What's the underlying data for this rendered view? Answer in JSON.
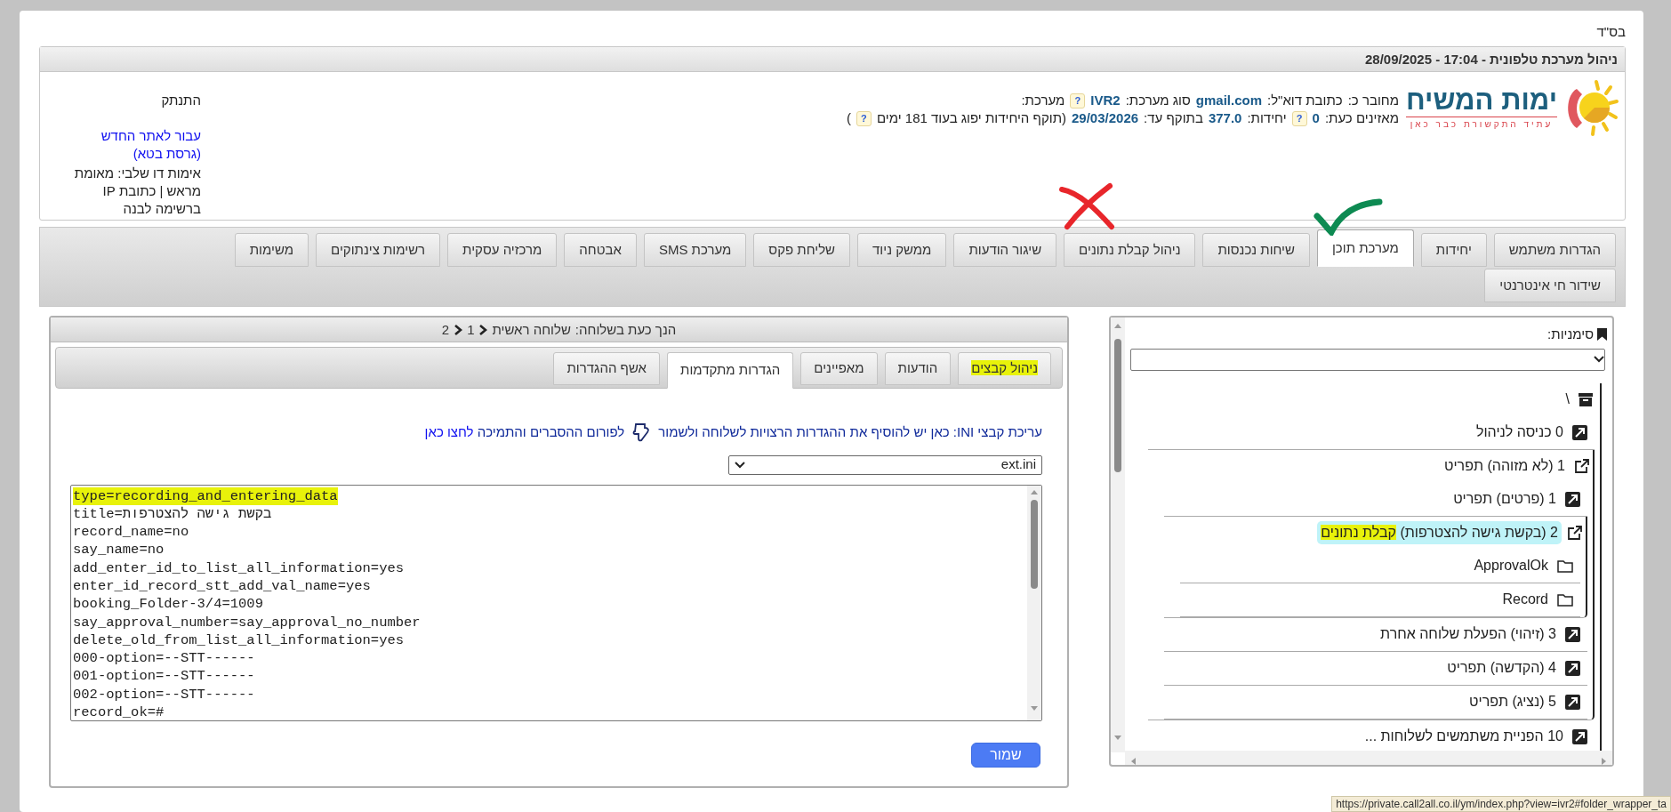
{
  "page_mark": "בס\"ד",
  "header": {
    "title": "ניהול מערכת טלפונית - 17:04 - 28/09/2025",
    "logo": {
      "name": "ימות המשיח",
      "slogan": "עתיד התקשורת כבר כאן"
    },
    "info_lines": [
      [
        {
          "kind": "label",
          "text": "מחובר כ:"
        },
        {
          "kind": "label",
          "text": "כתובת דוא\"ל:"
        },
        {
          "kind": "value",
          "text": "gmail.com"
        },
        {
          "kind": "label",
          "text": "סוג מערכת:"
        },
        {
          "kind": "value",
          "text": "IVR2"
        },
        {
          "kind": "help",
          "text": "?"
        },
        {
          "kind": "label",
          "text": "מערכת:"
        }
      ],
      [
        {
          "kind": "label",
          "text": "מאזינים כעת:"
        },
        {
          "kind": "value",
          "text": "0"
        },
        {
          "kind": "help",
          "text": "?"
        },
        {
          "kind": "label",
          "text": "יחידות:"
        },
        {
          "kind": "value",
          "text": "377.0"
        },
        {
          "kind": "label",
          "text": "בתוקף עד:"
        },
        {
          "kind": "value",
          "text": "29/03/2026"
        },
        {
          "kind": "label",
          "text": "(תוקף היחידות יפוג בעוד 181 ימים"
        },
        {
          "kind": "help",
          "text": "?"
        },
        {
          "kind": "label",
          "text": ")"
        }
      ]
    ],
    "side": {
      "logout": "התנתק",
      "new_site_link": "עבור לאתר החדש (גרסת בטא)",
      "two_factor": "אימות דו שלבי: מאומת מראש | כתובת IP ברשימה לבנה"
    }
  },
  "main_tabs": [
    {
      "label": "הגדרות משתמש",
      "selected": false
    },
    {
      "label": "יחידות",
      "selected": false
    },
    {
      "label": "מערכת תוכן",
      "selected": true
    },
    {
      "label": "שיחות נכנסות",
      "selected": false
    },
    {
      "label": "ניהול קבלת נתונים",
      "selected": false
    },
    {
      "label": "שיגור הודעות",
      "selected": false
    },
    {
      "label": "ממשק ניוד",
      "selected": false
    },
    {
      "label": "שליחת פקס",
      "selected": false
    },
    {
      "label": "מערכת SMS",
      "selected": false
    },
    {
      "label": "אבטחה",
      "selected": false
    },
    {
      "label": "מרכזיה עסקית",
      "selected": false
    },
    {
      "label": "רשימות צינתוקים",
      "selected": false
    },
    {
      "label": "משימות",
      "selected": false
    },
    {
      "label": "שידור חי אינטרנטי",
      "selected": false
    }
  ],
  "extension_panel": {
    "breadcrumb_label": "הנך כעת בשלוחה:",
    "breadcrumbs": [
      "שלוחה ראשית",
      "1",
      "2"
    ],
    "tabs": [
      {
        "label": "ניהול קבצים",
        "selected": false,
        "highlighted": true
      },
      {
        "label": "הודעות",
        "selected": false,
        "highlighted": false
      },
      {
        "label": "מאפיינים",
        "selected": false,
        "highlighted": false
      },
      {
        "label": "הגדרות מתקדמות",
        "selected": true,
        "highlighted": false
      },
      {
        "label": "אשף ההגדרות",
        "selected": false,
        "highlighted": false
      }
    ],
    "instructions": {
      "text": "עריכת קבצי INI: כאן יש להוסיף את ההגדרות הרצויות לשלוחה ולשמור",
      "forum_text": "לפורום ההסברים והתמיכה",
      "forum_link": "לחצו כאן"
    },
    "file_select": {
      "value": "ext.ini"
    },
    "file_lines": [
      {
        "text": "type=recording_and_entering_data",
        "highlighted": true
      },
      {
        "text": "title=בקשת גישה להצטרפות",
        "highlighted": false
      },
      {
        "text": "record_name=no",
        "highlighted": false
      },
      {
        "text": "say_name=no",
        "highlighted": false
      },
      {
        "text": "add_enter_id_to_list_all_information=yes",
        "highlighted": false
      },
      {
        "text": "enter_id_record_stt_add_val_name=yes",
        "highlighted": false
      },
      {
        "text": "booking_Folder-3/4=1009",
        "highlighted": false
      },
      {
        "text": "say_approval_number=say_approval_no_number",
        "highlighted": false
      },
      {
        "text": "delete_old_from_list_all_information=yes",
        "highlighted": false
      },
      {
        "text": "000-option=--STT------",
        "highlighted": false
      },
      {
        "text": "001-option=--STT------",
        "highlighted": false
      },
      {
        "text": "002-option=--STT------",
        "highlighted": false
      },
      {
        "text": "record_ok=#",
        "highlighted": false
      }
    ],
    "save_button": "שמור"
  },
  "tree_panel": {
    "bookmarks_label": "סימניות:",
    "root": {
      "label": "\\",
      "children": [
        {
          "label": "0 כניסה לניהול",
          "kind": "extension",
          "expanded": false,
          "selected": false
        },
        {
          "label": "1 (לא מזוהה) תפריט",
          "kind": "extension",
          "expanded": true,
          "selected": false,
          "children": [
            {
              "label": "1 (פרטים) תפריט",
              "kind": "extension",
              "expanded": false,
              "selected": false
            },
            {
              "label": "2 (בקשת גישה להצטרפות)",
              "highlighted_text": "קבלת נתונים",
              "kind": "extension",
              "expanded": true,
              "selected": true,
              "children": [
                {
                  "label": "ApprovalOk",
                  "kind": "folder",
                  "selected": false
                },
                {
                  "label": "Record",
                  "kind": "folder",
                  "selected": false
                }
              ]
            },
            {
              "label": "3 (זיהוי) הפעלת שלוחה אחרת",
              "kind": "extension",
              "expanded": false,
              "selected": false
            },
            {
              "label": "4 (הקדשה) תפריט",
              "kind": "extension",
              "expanded": false,
              "selected": false
            },
            {
              "label": "5 (נציג) תפריט",
              "kind": "extension",
              "expanded": false,
              "selected": false
            }
          ]
        },
        {
          "label": "10 הפניית משתמשים לשלוחות ...",
          "kind": "extension",
          "expanded": false,
          "selected": false
        }
      ]
    }
  },
  "status_url": "https://private.call2all.co.il/ym/index.php?view=ivr2#folder_wrapper_ta"
}
